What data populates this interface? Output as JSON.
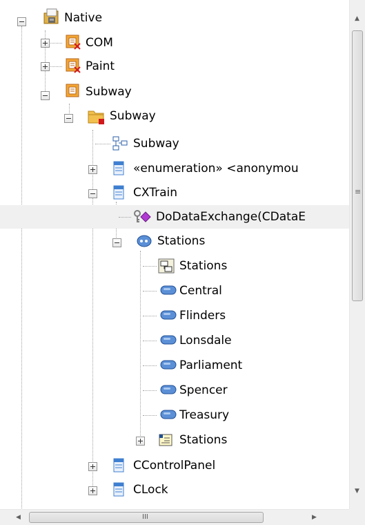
{
  "tree": {
    "native": "Native",
    "com": "COM",
    "paint": "Paint",
    "subway_package": "Subway",
    "subway_folder": "Subway",
    "subway_diagram": "Subway",
    "enumeration": "«enumeration» <anonymou",
    "cxtrain": "CXTrain",
    "dodataexchange": "DoDataExchange(CDataE",
    "stations_enum": "Stations",
    "stations_diagram": "Stations",
    "literals": [
      "Central",
      "Flinders",
      "Lonsdale",
      "Parliament",
      "Spencer",
      "Treasury"
    ],
    "stations_sub": "Stations",
    "ccontrolpanel": "CControlPanel",
    "clock": "CLock"
  },
  "scrollbar": {
    "up": "▲",
    "down": "▼",
    "left": "◀",
    "right": "▶",
    "vgrip": "≡",
    "hgrip": "III"
  },
  "colors": {
    "selected_row": "#f0f0f0",
    "class_blue": "#3f7fd0",
    "package_orange": "#e8a33a",
    "enum_blue": "#5b8fd6"
  }
}
